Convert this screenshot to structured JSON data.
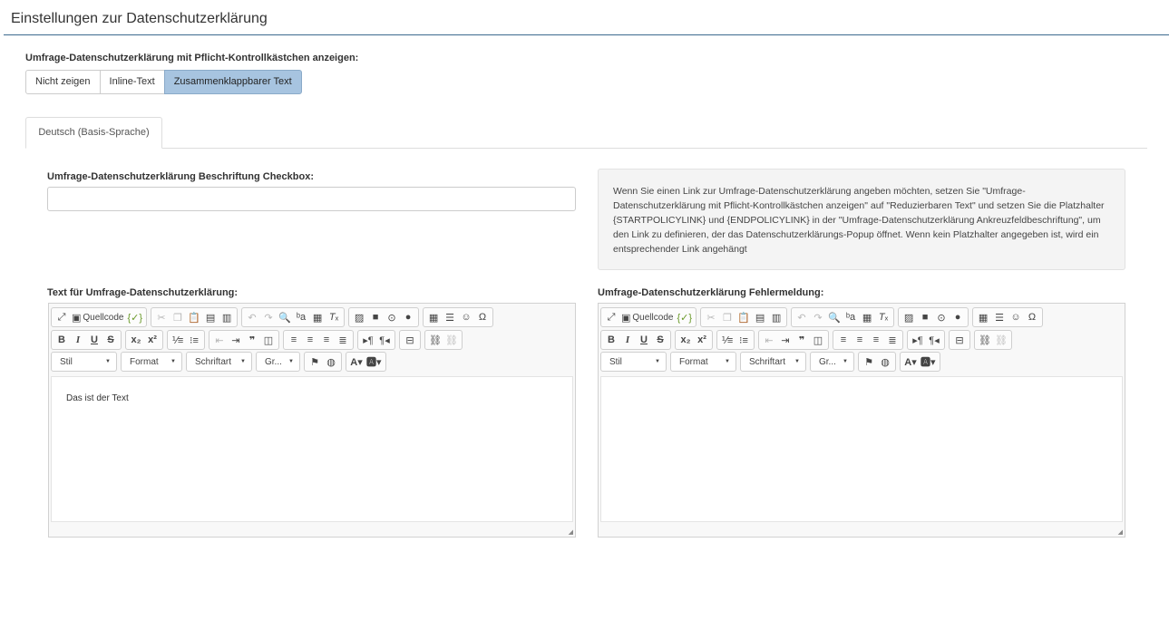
{
  "page": {
    "title": "Einstellungen zur Datenschutzerklärung"
  },
  "policy_display": {
    "label": "Umfrage-Datenschutzerklärung mit Pflicht-Kontrollkästchen anzeigen:",
    "options": [
      "Nicht zeigen",
      "Inline-Text",
      "Zusammenklappbarer Text"
    ],
    "selected": "Zusammenklappbarer Text"
  },
  "language_tab": {
    "label": "Deutsch (Basis-Sprache)"
  },
  "checkbox_caption": {
    "label": "Umfrage-Datenschutzerklärung Beschriftung Checkbox:",
    "value": ""
  },
  "info_text": "Wenn Sie einen Link zur Umfrage-Datenschutzerklärung angeben möchten, setzen Sie \"Umfrage-Datenschutzerklärung mit Pflicht-Kontrollkästchen anzeigen\" auf \"Reduzierbaren Text\" und setzen Sie die Platzhalter {STARTPOLICYLINK} und {ENDPOLICYLINK} in der \"Umfrage-Datenschutzerklärung Ankreuzfeldbeschriftung\", um den Link zu definieren, der das Datenschutzerklärungs-Popup öffnet. Wenn kein Platzhalter angegeben ist, wird ein entsprechender Link angehängt",
  "editor_policy_text": {
    "label": "Text für Umfrage-Datenschutzerklärung:",
    "content": "Das ist der Text"
  },
  "editor_error_message": {
    "label": "Umfrage-Datenschutzerklärung Fehlermeldung:",
    "content": ""
  },
  "toolbar": {
    "source_label": "Quellcode",
    "combo_style": "Stil",
    "combo_format": "Format",
    "combo_font": "Schriftart",
    "combo_size": "Gr..."
  },
  "accent_color": "#a7c4e0",
  "rule_color": "#3d6a8e"
}
